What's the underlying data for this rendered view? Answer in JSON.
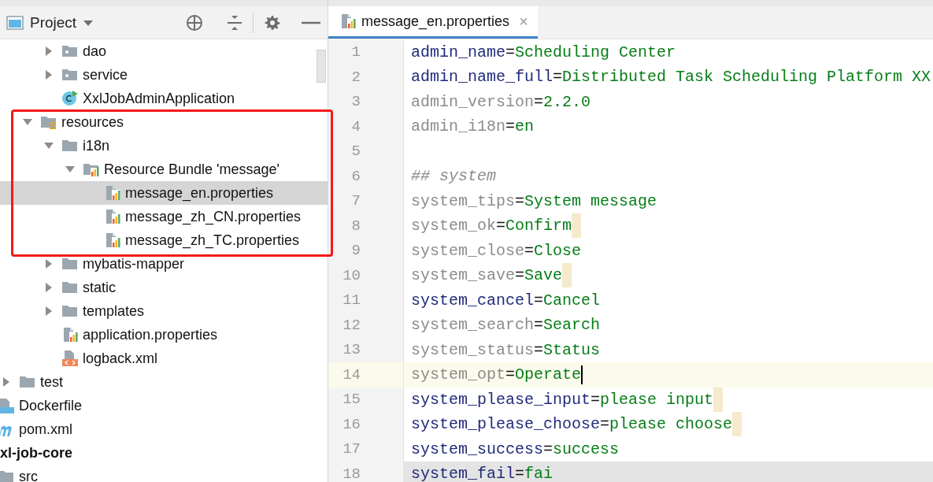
{
  "project_panel": {
    "title": "Project"
  },
  "annotation": {
    "kind": "frame"
  },
  "tree": [
    {
      "children": [
        {
          "children": [
            {
              "children": [
                {
                  "children": [
                    {
                      "label": "dao",
                      "kind": "package",
                      "expanded": false,
                      "selected": false
                    },
                    {
                      "label": "service",
                      "kind": "package",
                      "expanded": false,
                      "selected": false
                    },
                    {
                      "label": "XxlJobAdminApplication",
                      "kind": "class",
                      "selected": false
                    }
                  ]
                },
                {
                  "label": "resources",
                  "kind": "resources-folder",
                  "expanded": true,
                  "selected": false,
                  "children": [
                    {
                      "label": "i18n",
                      "kind": "folder",
                      "expanded": true,
                      "selected": false,
                      "children": [
                        {
                          "label": "Resource Bundle 'message'",
                          "kind": "bundle",
                          "expanded": true,
                          "selected": false,
                          "children": [
                            {
                              "label": "message_en.properties",
                              "kind": "properties",
                              "selected": true
                            },
                            {
                              "label": "message_zh_CN.properties",
                              "kind": "properties",
                              "selected": false
                            },
                            {
                              "label": "message_zh_TC.properties",
                              "kind": "properties",
                              "selected": false
                            }
                          ]
                        }
                      ]
                    },
                    {
                      "label": "mybatis-mapper",
                      "kind": "folder",
                      "expanded": false,
                      "selected": false
                    },
                    {
                      "label": "static",
                      "kind": "folder",
                      "expanded": false,
                      "selected": false
                    },
                    {
                      "label": "templates",
                      "kind": "folder",
                      "expanded": false,
                      "selected": false
                    },
                    {
                      "label": "application.properties",
                      "kind": "properties",
                      "selected": false
                    },
                    {
                      "label": "logback.xml",
                      "kind": "xml",
                      "selected": false
                    }
                  ]
                }
              ]
            },
            {
              "label": "test",
              "kind": "folder",
              "expanded": false,
              "selected": false
            }
          ]
        },
        {
          "label": "Dockerfile",
          "kind": "dockerfile",
          "selected": false
        },
        {
          "label": "pom.xml",
          "kind": "maven",
          "selected": false
        }
      ]
    },
    {
      "label": "xl-job-core",
      "kind": "module",
      "selected": false,
      "children": [
        {
          "label": "src",
          "kind": "folder",
          "selected": false
        }
      ]
    }
  ],
  "editor": {
    "tabs": [
      {
        "label": "message_en.properties",
        "kind": "properties",
        "selected": true,
        "close": "×"
      }
    ],
    "lines": [
      {
        "number": "1",
        "kind": "property",
        "key": "admin_name",
        "separator": "=",
        "value": "Scheduling Center",
        "used": true,
        "trailing_space": false,
        "current": false,
        "highlighted": false
      },
      {
        "number": "2",
        "kind": "property",
        "key": "admin_name_full",
        "separator": "=",
        "value": "Distributed Task Scheduling Platform XX",
        "used": true,
        "trailing_space": false,
        "current": false,
        "highlighted": false
      },
      {
        "number": "3",
        "kind": "property",
        "key": "admin_version",
        "separator": "=",
        "value": "2.2.0",
        "used": false,
        "trailing_space": false,
        "current": false,
        "highlighted": false
      },
      {
        "number": "4",
        "kind": "property",
        "key": "admin_i18n",
        "separator": "=",
        "value": "en",
        "used": false,
        "trailing_space": false,
        "current": false,
        "highlighted": false
      },
      {
        "number": "5",
        "kind": "blank"
      },
      {
        "number": "6",
        "kind": "comment",
        "text": "## system"
      },
      {
        "number": "7",
        "kind": "property",
        "key": "system_tips",
        "separator": "=",
        "value": "System message",
        "used": false,
        "trailing_space": false,
        "current": false,
        "highlighted": false
      },
      {
        "number": "8",
        "kind": "property",
        "key": "system_ok",
        "separator": "=",
        "value": "Confirm",
        "used": false,
        "trailing_space": true,
        "current": false,
        "highlighted": false
      },
      {
        "number": "9",
        "kind": "property",
        "key": "system_close",
        "separator": "=",
        "value": "Close",
        "used": false,
        "trailing_space": false,
        "current": false,
        "highlighted": false
      },
      {
        "number": "10",
        "kind": "property",
        "key": "system_save",
        "separator": "=",
        "value": "Save",
        "used": false,
        "trailing_space": true,
        "current": false,
        "highlighted": false
      },
      {
        "number": "11",
        "kind": "property",
        "key": "system_cancel",
        "separator": "=",
        "value": "Cancel",
        "used": true,
        "trailing_space": false,
        "current": false,
        "highlighted": false
      },
      {
        "number": "12",
        "kind": "property",
        "key": "system_search",
        "separator": "=",
        "value": "Search",
        "used": false,
        "trailing_space": false,
        "current": false,
        "highlighted": false
      },
      {
        "number": "13",
        "kind": "property",
        "key": "system_status",
        "separator": "=",
        "value": "Status",
        "used": false,
        "trailing_space": false,
        "current": false,
        "highlighted": false
      },
      {
        "number": "14",
        "kind": "property",
        "key": "system_opt",
        "separator": "=",
        "value": "Operate",
        "used": false,
        "trailing_space": false,
        "current": true,
        "highlighted": false
      },
      {
        "number": "15",
        "kind": "property",
        "key": "system_please_input",
        "separator": "=",
        "value": "please input",
        "used": true,
        "trailing_space": true,
        "current": false,
        "highlighted": false
      },
      {
        "number": "16",
        "kind": "property",
        "key": "system_please_choose",
        "separator": "=",
        "value": "please choose",
        "used": true,
        "trailing_space": true,
        "current": false,
        "highlighted": false
      },
      {
        "number": "17",
        "kind": "property",
        "key": "system_success",
        "separator": "=",
        "value": "success",
        "used": true,
        "trailing_space": false,
        "current": false,
        "highlighted": false
      },
      {
        "number": "18",
        "kind": "property",
        "key": "system_fail",
        "separator": "=",
        "value": "fai",
        "used": true,
        "trailing_space": false,
        "current": false,
        "highlighted": true
      }
    ]
  }
}
